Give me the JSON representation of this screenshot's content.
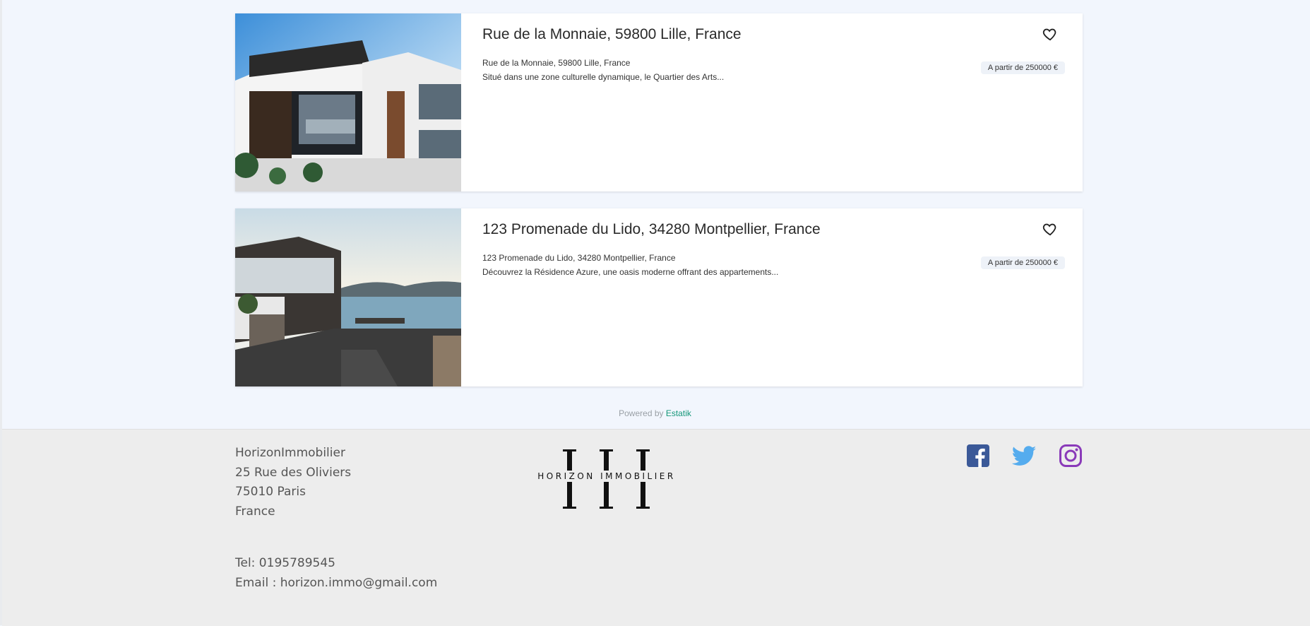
{
  "listings": [
    {
      "title": "Rue de la Monnaie, 59800 Lille, France",
      "address": "Rue de la Monnaie, 59800 Lille, France",
      "excerpt": "Situé dans une zone culturelle dynamique, le Quartier des Arts...",
      "price": "A partir de 250000 €",
      "image": "modern-villa-photo"
    },
    {
      "title": "123 Promenade du Lido, 34280 Montpellier, France",
      "address": "123 Promenade du Lido, 34280 Montpellier, France",
      "excerpt": "Découvrez la Résidence Azure, une oasis moderne offrant des appartements...",
      "price": "A partir de 250000 €",
      "image": "seaside-villa-photo"
    }
  ],
  "powered": {
    "prefix": "Powered by",
    "link": "Estatik"
  },
  "footer": {
    "company": "HorizonImmobilier",
    "street": "25 Rue des Oliviers",
    "city": "75010 Paris",
    "country": "France",
    "tel": "Tel: 0195789545",
    "email": "Email : horizon.immo@gmail.com",
    "logo_text": "HORIZON IMMOBILIER"
  },
  "social": [
    "facebook-icon",
    "twitter-icon",
    "instagram-icon"
  ],
  "colors": {
    "background": "#f2f6fd",
    "footer": "#ededed",
    "link": "#16977a",
    "facebook": "#3b5998",
    "twitter": "#55acee",
    "instagram": "#8a3ab9"
  }
}
